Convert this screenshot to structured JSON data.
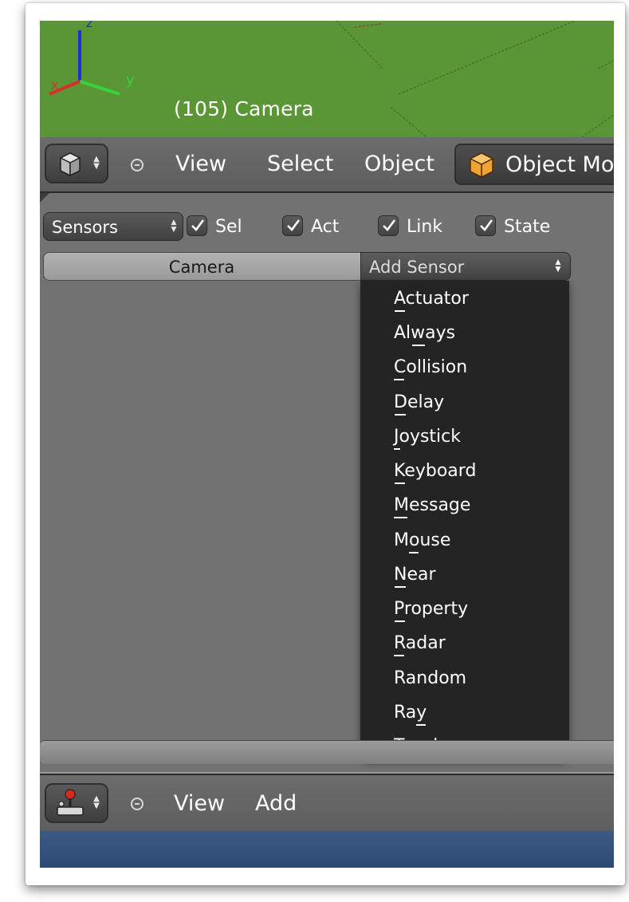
{
  "viewport": {
    "label": "(105) Camera",
    "axes": {
      "z": "z",
      "y": "y",
      "x": "x"
    },
    "background_color": "#5b9636"
  },
  "view3d_header": {
    "editor_icon": "cube-icon",
    "collapse_icon": "circle-minus-icon",
    "menu": [
      "View",
      "Select",
      "Object"
    ],
    "mode_icon": "orange-cube-icon",
    "mode_label": "Object Mo"
  },
  "logic_editor": {
    "sensors_select": "Sensors",
    "checkboxes": [
      {
        "label": "Sel",
        "checked": true
      },
      {
        "label": "Act",
        "checked": true
      },
      {
        "label": "Link",
        "checked": true
      },
      {
        "label": "State",
        "checked": true
      }
    ],
    "object_name": "Camera",
    "add_sensor_label": "Add Sensor",
    "sensor_menu": [
      {
        "label": "Actuator",
        "underline": "A"
      },
      {
        "label": "Always",
        "underline": "w"
      },
      {
        "label": "Collision",
        "underline": "C"
      },
      {
        "label": "Delay",
        "underline": "D"
      },
      {
        "label": "Joystick",
        "underline": "J"
      },
      {
        "label": "Keyboard",
        "underline": "K"
      },
      {
        "label": "Message",
        "underline": "M"
      },
      {
        "label": "Mouse",
        "underline": "o"
      },
      {
        "label": "Near",
        "underline": "N"
      },
      {
        "label": "Property",
        "underline": "P"
      },
      {
        "label": "Radar",
        "underline": "R"
      },
      {
        "label": "Random",
        "underline": ""
      },
      {
        "label": "Ray",
        "underline": "y"
      },
      {
        "label": "Touch",
        "underline": "T"
      }
    ]
  },
  "bottom_header": {
    "editor_icon": "joystick-icon",
    "collapse_icon": "circle-minus-icon",
    "menu": [
      "View",
      "Add"
    ]
  },
  "colors": {
    "viewport_green": "#5b9636",
    "panel_gray": "#727272",
    "menu_dark": "#242424",
    "header_blue": "#3b5a86"
  }
}
